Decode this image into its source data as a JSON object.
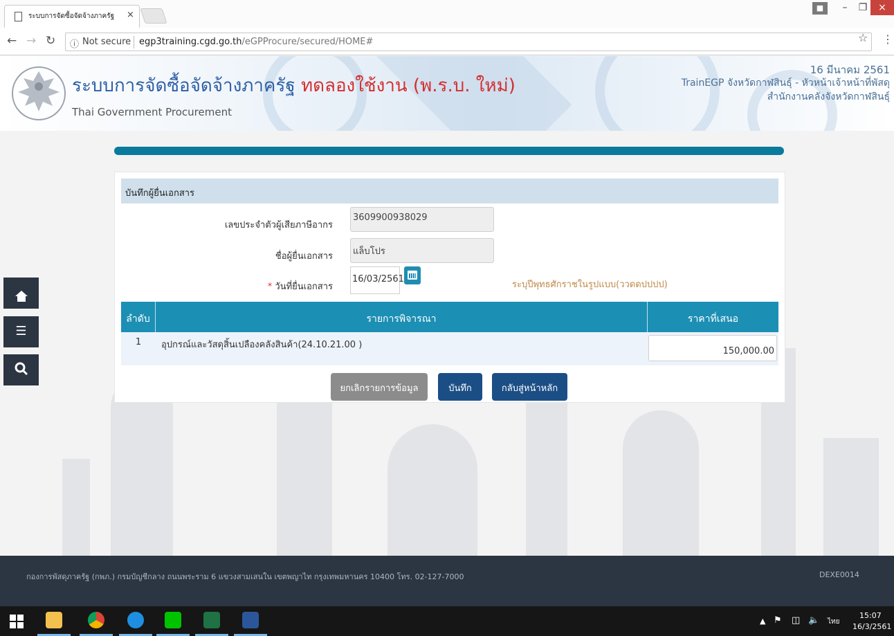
{
  "browser": {
    "tab_title": "ระบบการจัดซื้อจัดจ้างภาครัฐ",
    "tab_close": "×",
    "security_label": "Not secure",
    "url_host": "egp3training.cgd.go.th",
    "url_path": "/eGPProcure/secured/HOME#"
  },
  "header": {
    "title_main": "ระบบการจัดซื้อจัดจ้างภาครัฐ",
    "title_trial": "ทดลองใช้งาน (พ.ร.บ. ใหม่)",
    "subtitle": "Thai Government Procurement",
    "date": "16 มีนาคม 2561",
    "user": "TrainEGP จังหวัดกาฬสินธุ์ - หัวหน้าเจ้าหน้าที่พัสดุ",
    "office": "สำนักงานคลังจังหวัดกาฬสินธุ์"
  },
  "form": {
    "panel_title": "บันทึกผู้ยื่นเอกสาร",
    "taxid_label": "เลขประจำตัวผู้เสียภาษีอากร",
    "taxid_value": "3609900938029",
    "name_label": "ชื่อผู้ยื่นเอกสาร",
    "name_value": "แล็บโปร",
    "date_required_mark": "*",
    "date_label": "วันที่ยื่นเอกสาร",
    "date_value": "16/03/2561",
    "date_hint": "ระบุปีพุทธศักราชในรูปแบบ(ววดดปปปป)"
  },
  "table": {
    "columns": [
      "ลำดับ",
      "รายการพิจารณา",
      "ราคาที่เสนอ"
    ],
    "rows": [
      {
        "no": "1",
        "item": "อุปกรณ์และวัสดุสิ้นเปลืองคลังสินค้า(24.10.21.00 )",
        "price": "150,000.00"
      }
    ]
  },
  "buttons": {
    "cancel": "ยกเลิกรายการข้อมูล",
    "save": "บันทึก",
    "home": "กลับสู่หน้าหลัก"
  },
  "footer": {
    "address": "กองการพัสดุภาครัฐ (กพภ.) กรมบัญชีกลาง ถนนพระราม 6 แขวงสามเสนใน เขตพญาไท กรุงเทพมหานคร 10400 โทร. 02-127-7000",
    "screen_code": "DEXE0014"
  },
  "taskbar": {
    "language": "ไทย",
    "time": "15:07",
    "date": "16/3/2561"
  },
  "icons": {
    "nav": [
      "home-icon",
      "menu-icon",
      "search-icon"
    ],
    "taskbar": [
      "windows-start-icon",
      "file-explorer-icon",
      "chrome-icon",
      "internet-explorer-icon",
      "line-icon",
      "excel-icon",
      "word-icon"
    ]
  },
  "colors": {
    "accent_teal": "#1c8fb4",
    "button_navy": "#1c4e86",
    "title_blue": "#2d5fa5",
    "trial_red": "#d32f2f",
    "footer_dark": "#2c3542"
  }
}
